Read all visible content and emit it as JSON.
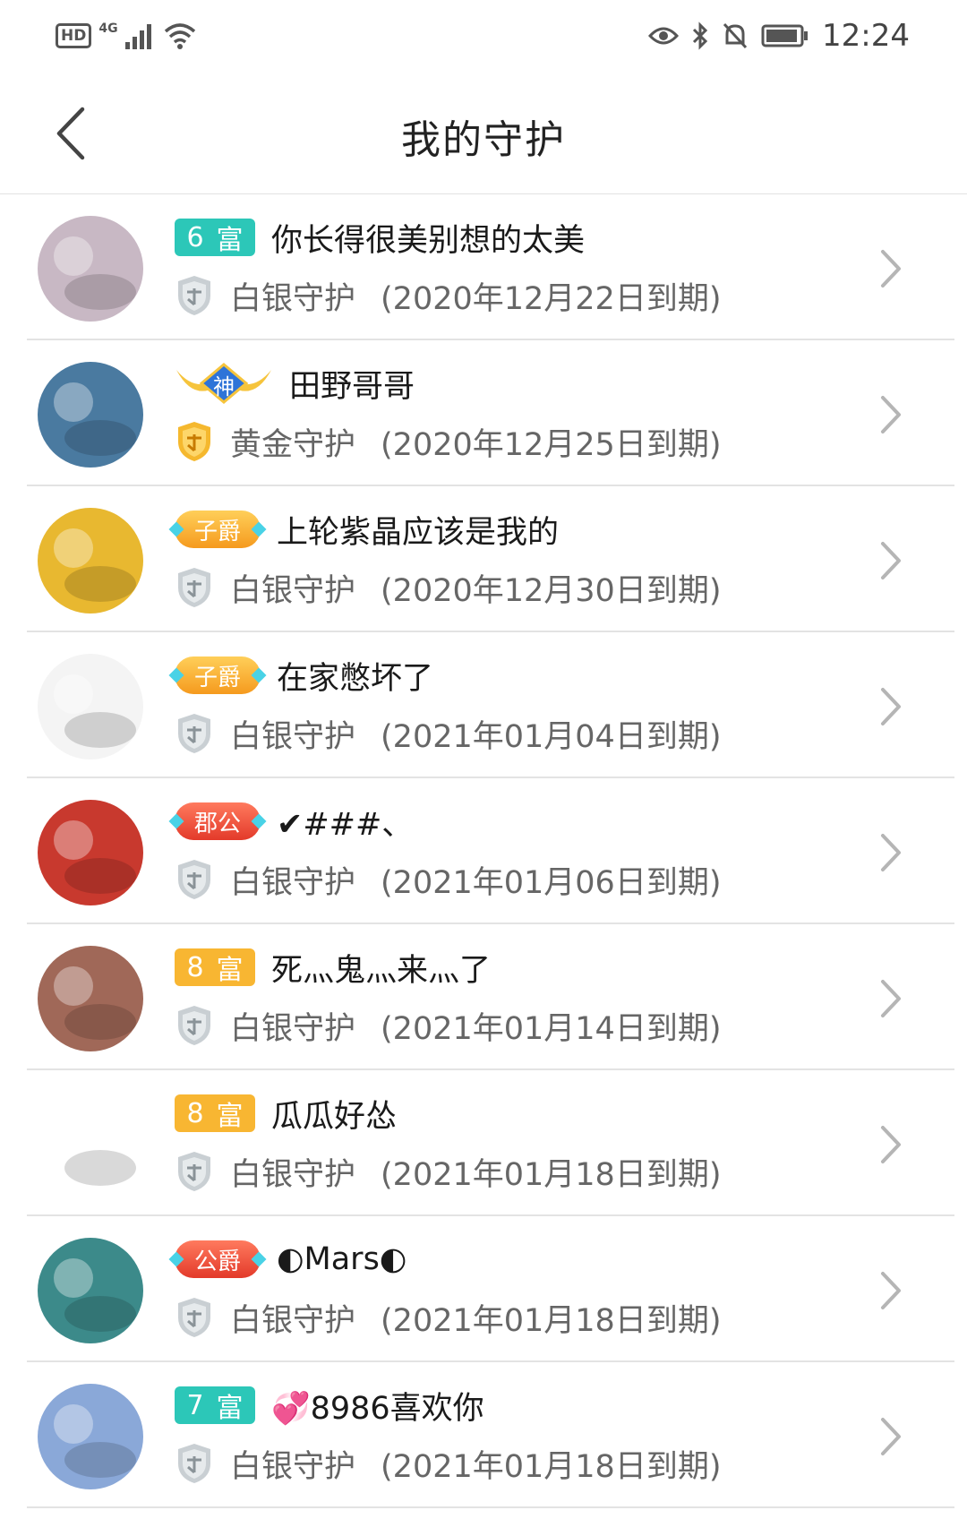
{
  "status_bar": {
    "hd": "HD",
    "network": "4G",
    "time": "12:24",
    "icons": [
      "eye-icon",
      "bluetooth-icon",
      "bell-off-icon",
      "battery-icon"
    ]
  },
  "header": {
    "title": "我的守护",
    "back_icon": "chevron-left-icon"
  },
  "guards": [
    {
      "badge_type": "fu",
      "badge_num": "6",
      "badge_text": "富",
      "badge_color": "#2cc7b8",
      "name": "你长得很美别想的太美",
      "guard_level": "白银守护",
      "expire": "(2020年12月22日到期)",
      "avatar_color": "#c8b8c4",
      "shield": "silver"
    },
    {
      "badge_type": "shen",
      "badge_text": "神",
      "name": "田野哥哥",
      "guard_level": "黄金守护",
      "expire": "(2020年12月25日到期)",
      "avatar_color": "#4a7aa0",
      "shield": "gold"
    },
    {
      "badge_type": "title",
      "badge_text": "子爵",
      "badge_style": "orange",
      "name": "上轮紫晶应该是我的",
      "guard_level": "白银守护",
      "expire": "(2020年12月30日到期)",
      "avatar_color": "#e8b830",
      "shield": "silver"
    },
    {
      "badge_type": "title",
      "badge_text": "子爵",
      "badge_style": "orange",
      "name": "在家憋坏了",
      "guard_level": "白银守护",
      "expire": "(2021年01月04日到期)",
      "avatar_color": "#f4f4f4",
      "shield": "silver"
    },
    {
      "badge_type": "title",
      "badge_text": "郡公",
      "badge_style": "red",
      "name": "✔###、",
      "guard_level": "白银守护",
      "expire": "(2021年01月06日到期)",
      "avatar_color": "#c8392e",
      "shield": "silver"
    },
    {
      "badge_type": "fu",
      "badge_num": "8",
      "badge_text": "富",
      "badge_color": "#f8b632",
      "name": "死灬鬼灬来灬了",
      "guard_level": "白银守护",
      "expire": "(2021年01月14日到期)",
      "avatar_color": "#a06858",
      "shield": "silver"
    },
    {
      "badge_type": "fu",
      "badge_num": "8",
      "badge_text": "富",
      "badge_color": "#f8b632",
      "name": "瓜瓜好怂",
      "guard_level": "白银守护",
      "expire": "(2021年01月18日到期)",
      "avatar_color": "#ffffff",
      "shield": "silver"
    },
    {
      "badge_type": "title",
      "badge_text": "公爵",
      "badge_style": "red",
      "name": "◐Mars◐",
      "guard_level": "白银守护",
      "expire": "(2021年01月18日到期)",
      "avatar_color": "#3c8a8a",
      "shield": "silver"
    },
    {
      "badge_type": "fu",
      "badge_num": "7",
      "badge_text": "富",
      "badge_color": "#2cc7b8",
      "name": "💞8986喜欢你",
      "guard_level": "白银守护",
      "expire": "(2021年01月18日到期)",
      "avatar_color": "#8aa8d8",
      "shield": "silver"
    }
  ]
}
